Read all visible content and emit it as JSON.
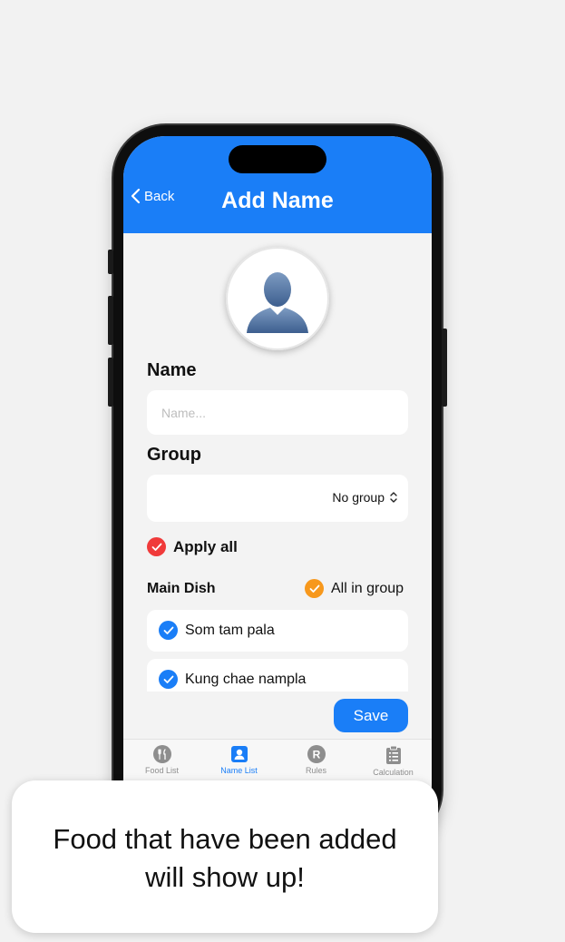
{
  "nav": {
    "back_label": "Back",
    "title": "Add Name"
  },
  "form": {
    "name_label": "Name",
    "name_placeholder": "Name...",
    "name_value": "",
    "group_label": "Group",
    "group_value": "No group",
    "apply_all_label": "Apply all"
  },
  "dishes": {
    "section_label": "Main Dish",
    "all_in_group_label": "All in group",
    "items": [
      {
        "label": "Som tam pala",
        "checked": true
      },
      {
        "label": "Kung chae nampla",
        "checked": true
      }
    ]
  },
  "save_label": "Save",
  "tabs": [
    {
      "label": "Food List",
      "icon": "fork-knife-icon",
      "active": false
    },
    {
      "label": "Name List",
      "icon": "person-card-icon",
      "active": true
    },
    {
      "label": "Rules",
      "icon": "r-circle-icon",
      "active": false
    },
    {
      "label": "Calculation",
      "icon": "clipboard-list-icon",
      "active": false
    }
  ],
  "toast": {
    "line1": "Food that have been added",
    "line2": "will show up!"
  },
  "colors": {
    "accent": "#1a7ef7",
    "apply_check": "#f03a3a",
    "group_check": "#f7981c",
    "dish_check": "#1a7ef7",
    "inactive_tab": "#8e8e8e"
  }
}
